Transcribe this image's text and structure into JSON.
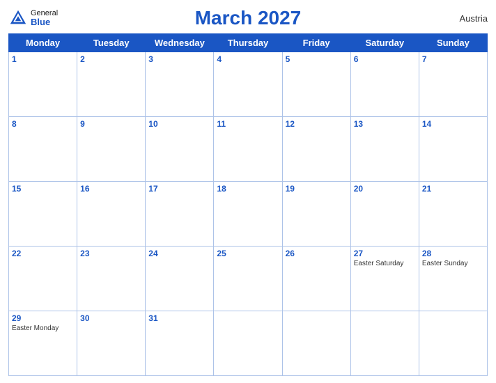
{
  "header": {
    "title": "March 2027",
    "country": "Austria",
    "logo_general": "General",
    "logo_blue": "Blue"
  },
  "weekdays": [
    "Monday",
    "Tuesday",
    "Wednesday",
    "Thursday",
    "Friday",
    "Saturday",
    "Sunday"
  ],
  "weeks": [
    [
      {
        "day": "1",
        "holiday": ""
      },
      {
        "day": "2",
        "holiday": ""
      },
      {
        "day": "3",
        "holiday": ""
      },
      {
        "day": "4",
        "holiday": ""
      },
      {
        "day": "5",
        "holiday": ""
      },
      {
        "day": "6",
        "holiday": ""
      },
      {
        "day": "7",
        "holiday": ""
      }
    ],
    [
      {
        "day": "8",
        "holiday": ""
      },
      {
        "day": "9",
        "holiday": ""
      },
      {
        "day": "10",
        "holiday": ""
      },
      {
        "day": "11",
        "holiday": ""
      },
      {
        "day": "12",
        "holiday": ""
      },
      {
        "day": "13",
        "holiday": ""
      },
      {
        "day": "14",
        "holiday": ""
      }
    ],
    [
      {
        "day": "15",
        "holiday": ""
      },
      {
        "day": "16",
        "holiday": ""
      },
      {
        "day": "17",
        "holiday": ""
      },
      {
        "day": "18",
        "holiday": ""
      },
      {
        "day": "19",
        "holiday": ""
      },
      {
        "day": "20",
        "holiday": ""
      },
      {
        "day": "21",
        "holiday": ""
      }
    ],
    [
      {
        "day": "22",
        "holiday": ""
      },
      {
        "day": "23",
        "holiday": ""
      },
      {
        "day": "24",
        "holiday": ""
      },
      {
        "day": "25",
        "holiday": ""
      },
      {
        "day": "26",
        "holiday": ""
      },
      {
        "day": "27",
        "holiday": "Easter Saturday"
      },
      {
        "day": "28",
        "holiday": "Easter Sunday"
      }
    ],
    [
      {
        "day": "29",
        "holiday": "Easter Monday"
      },
      {
        "day": "30",
        "holiday": ""
      },
      {
        "day": "31",
        "holiday": ""
      },
      {
        "day": "",
        "holiday": ""
      },
      {
        "day": "",
        "holiday": ""
      },
      {
        "day": "",
        "holiday": ""
      },
      {
        "day": "",
        "holiday": ""
      }
    ]
  ]
}
